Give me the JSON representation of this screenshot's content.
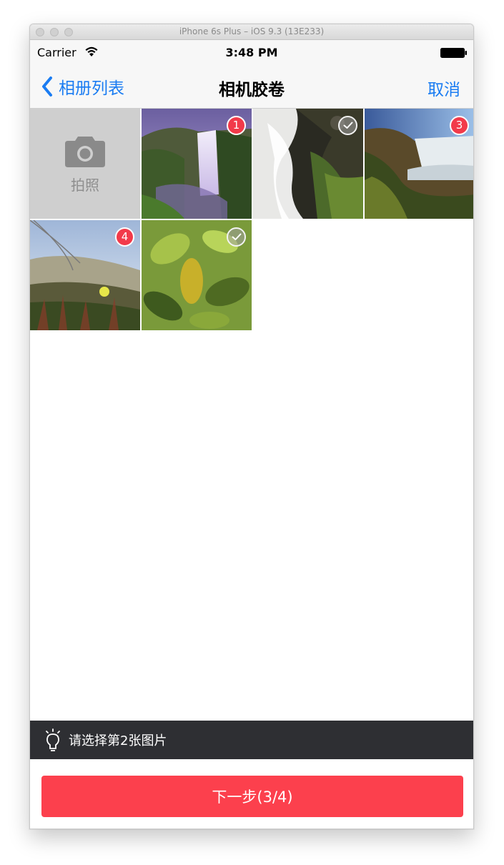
{
  "window": {
    "title": "iPhone 6s Plus – iOS 9.3 (13E233)"
  },
  "status_bar": {
    "carrier": "Carrier",
    "time": "3:48 PM",
    "wifi_icon": "wifi-icon",
    "battery_icon": "battery-icon"
  },
  "nav": {
    "back_label": "相册列表",
    "title": "相机胶卷",
    "cancel_label": "取消"
  },
  "grid": {
    "camera_label": "拍照",
    "camera_icon": "camera-icon",
    "photos": [
      {
        "scene": "waterfall-purple",
        "badge": "1",
        "state": "selected"
      },
      {
        "scene": "waterfall-rocks",
        "badge": "",
        "state": "unselected"
      },
      {
        "scene": "waterfall-wide",
        "badge": "3",
        "state": "selected"
      },
      {
        "scene": "dune-grass",
        "badge": "4",
        "state": "selected"
      },
      {
        "scene": "leaves",
        "badge": "",
        "state": "unselected"
      }
    ]
  },
  "tip": {
    "icon": "lightbulb-icon",
    "text": "请选择第2张图片"
  },
  "footer": {
    "next_label": "下一步(3/4)"
  },
  "colors": {
    "accent_blue": "#1a7cf2",
    "badge_red": "#f23a4a",
    "button_red": "#fc404d",
    "tip_bar_bg": "#2e2f33"
  }
}
